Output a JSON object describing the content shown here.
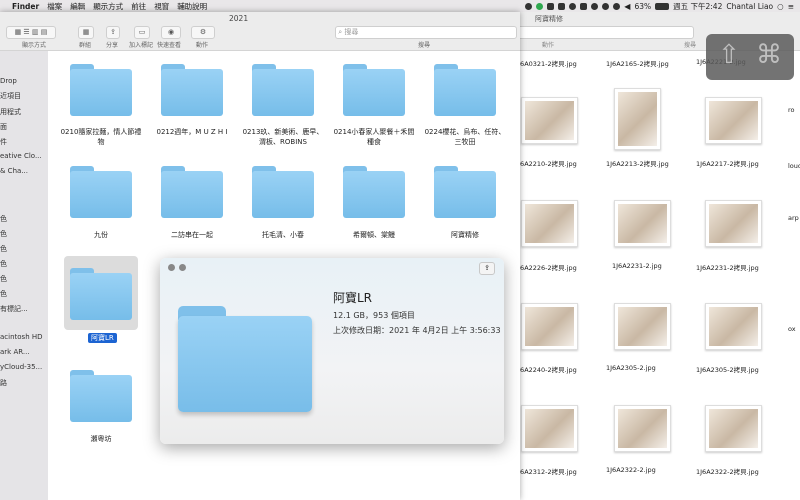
{
  "menubar": {
    "apple": "",
    "app": "Finder",
    "items": [
      "檔案",
      "編輯",
      "顯示方式",
      "前往",
      "視窗",
      "輔助說明"
    ],
    "battery": "63%",
    "clock": "週五 下午2:42",
    "user": "Chantal Liao"
  },
  "back_window": {
    "title": "阿寶精修",
    "action_label": "動作",
    "search_label": "搜尋",
    "files": [
      {
        "name": "1J6A0321-2拷貝.jpg"
      },
      {
        "name": "1J6A2165-2拷貝.jpg"
      },
      {
        "name": "1J6A2221-2.jpg"
      },
      {
        "name": "1J6A2210-2拷貝.jpg"
      },
      {
        "name": "1J6A2213-2拷貝.jpg"
      },
      {
        "name": "1J6A2217-2拷貝.jpg"
      },
      {
        "name": "1J6A2226-2拷貝.jpg"
      },
      {
        "name": "1J6A2231-2.jpg"
      },
      {
        "name": "1J6A2231-2拷貝.jpg"
      },
      {
        "name": "1J6A2240-2拷貝.jpg"
      },
      {
        "name": "1J6A2305-2.jpg"
      },
      {
        "name": "1J6A2305-2拷貝.jpg"
      },
      {
        "name": "1J6A2312-2拷貝.jpg"
      },
      {
        "name": "1J6A2322-2.jpg"
      },
      {
        "name": "1J6A2322-2拷貝.jpg"
      }
    ],
    "right_edge_labels": [
      "ro",
      "loud",
      "arp",
      "ox"
    ]
  },
  "hud": {
    "shift_icon": "⇧",
    "cmd_icon": "⌘"
  },
  "main_window": {
    "title": "2021",
    "toolbar": {
      "view_label": "顯示方式",
      "group_label": "群組",
      "share_label": "分享",
      "tag_label": "加入標記",
      "quicklook_label": "快速查看",
      "action_label": "動作",
      "search_placeholder": "搜尋",
      "search_label": "搜尋"
    },
    "sidebar": [
      "Drop",
      "近項目",
      "用程式",
      "面",
      "件",
      "eative Clo...",
      "& Cha...",
      "色",
      "色",
      "色",
      "色",
      "色",
      "色",
      "有標記...",
      "acintosh HD",
      "ark AR...",
      "yCloud-35...",
      "路"
    ],
    "folders": [
      {
        "label": "0210隨家拉麵，情人節禮物"
      },
      {
        "label": "0212週年，M U Z H I"
      },
      {
        "label": "0213玖、新美術、鹿早、渭板、ROBINS"
      },
      {
        "label": "0214小春家人聚餐＋禾間種食"
      },
      {
        "label": "0224櫻花、烏布、任符、三牧田"
      },
      {
        "label": "九份"
      },
      {
        "label": "二訪串在一起"
      },
      {
        "label": "托毛清、小春"
      },
      {
        "label": "希爾頓、棠鰻"
      },
      {
        "label": "阿寶精修"
      },
      {
        "label": "阿寶LR"
      },
      {
        "label": "瀬粵坊"
      }
    ]
  },
  "quicklook": {
    "name": "阿寶LR",
    "size": "12.1 GB，953 個項目",
    "modified": "上次修改日期：2021 年 4月2日 上午 3:56:33",
    "share_icon": "⇪"
  }
}
